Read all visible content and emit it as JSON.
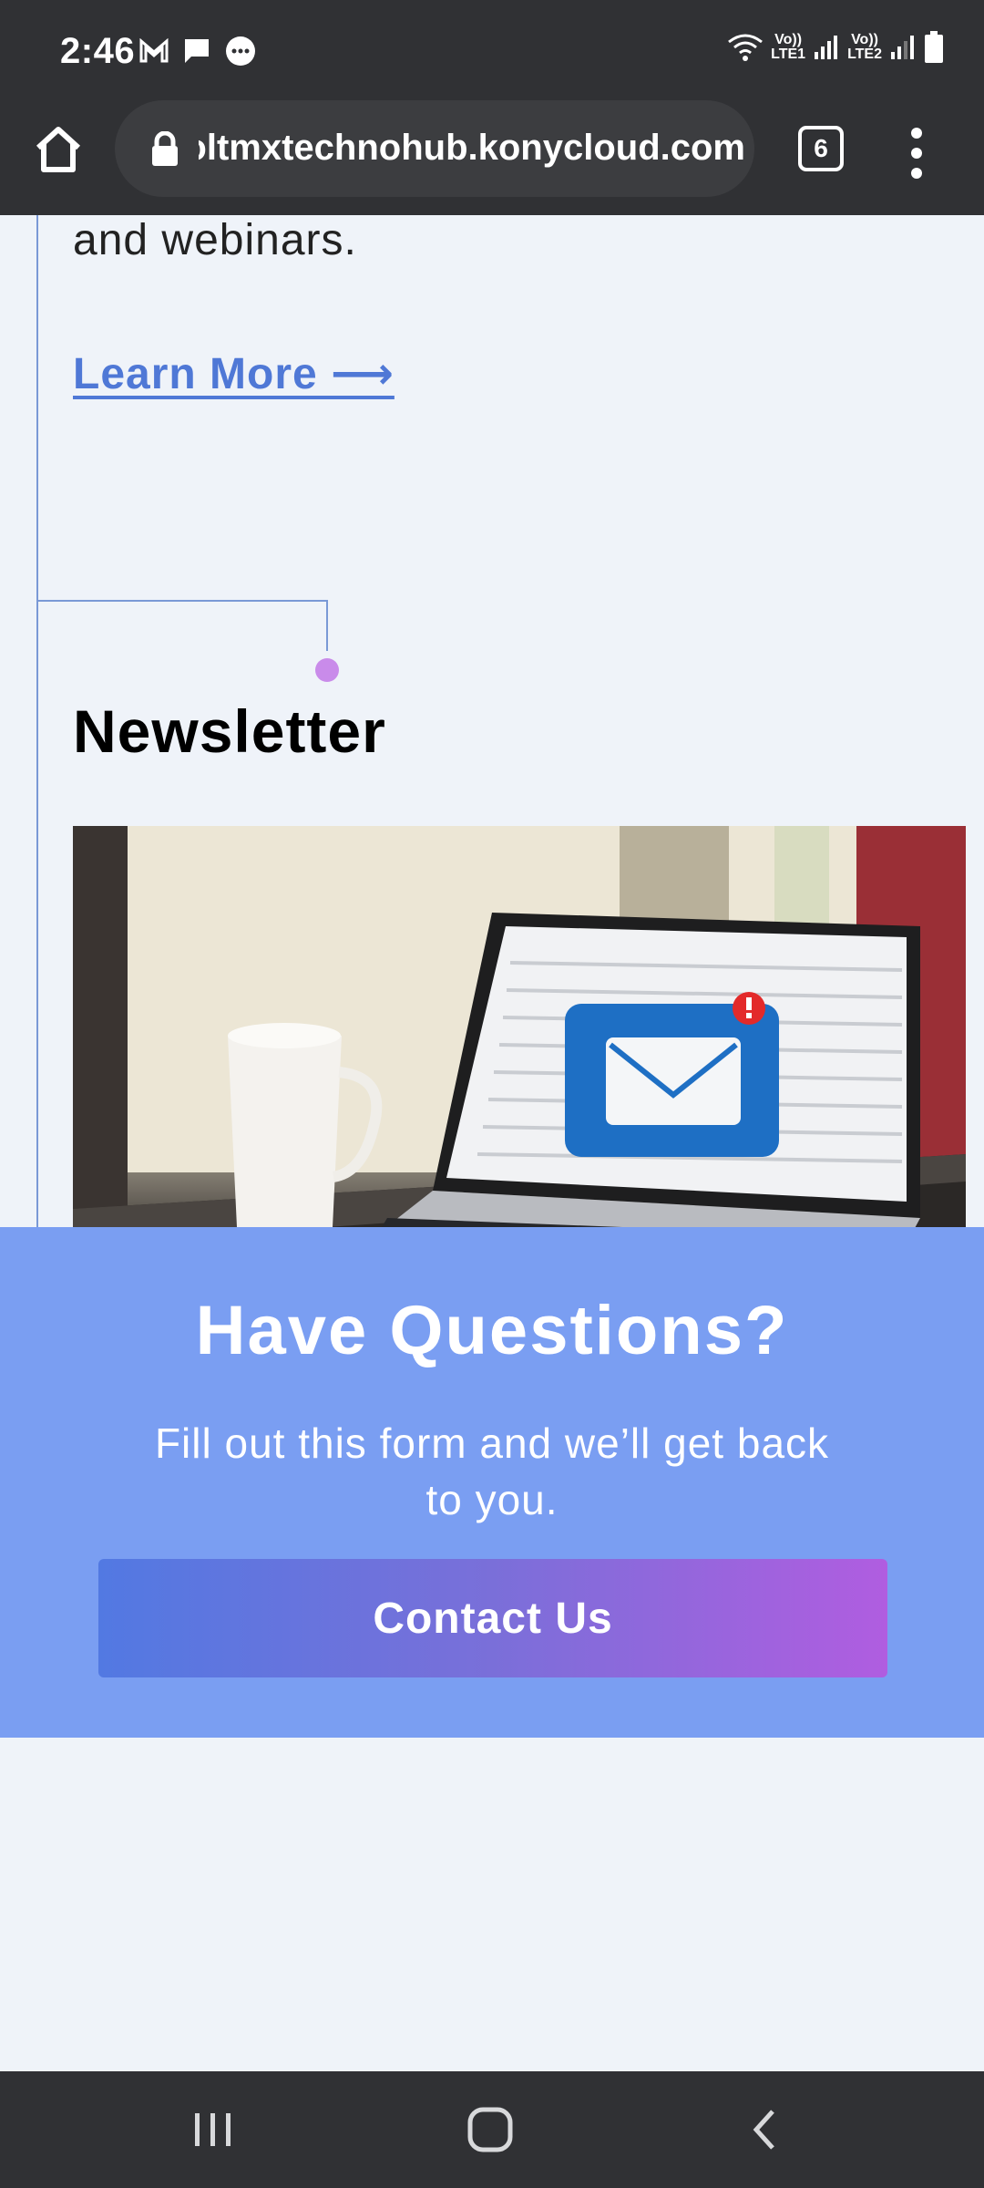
{
  "status_bar": {
    "time": "2:46",
    "lte1": "Vo))\nLTE1",
    "lte2": "Vo))\nLTE2"
  },
  "browser": {
    "url": "voltmxtechnohub.konycloud.com",
    "tab_count": "6"
  },
  "content": {
    "body_text_tail": "and webinars.",
    "learn_more": "Learn More ⟶",
    "newsletter_title": "Newsletter"
  },
  "cta": {
    "title": "Have Questions?",
    "subtitle": "Fill out this form and we’ll get back to you.",
    "button_label": "Contact Us"
  },
  "colors": {
    "accent_link": "#4f78d6",
    "cta_background": "#7a9ef2",
    "dot": "#c98bea"
  },
  "icons": [
    "gmail-icon",
    "message-icon",
    "chat-icon",
    "wifi-icon",
    "signal-icon",
    "battery-icon",
    "home-icon",
    "lock-icon",
    "tabs-icon",
    "more-vert-icon",
    "recent-apps-icon",
    "home-nav-icon",
    "back-icon"
  ]
}
